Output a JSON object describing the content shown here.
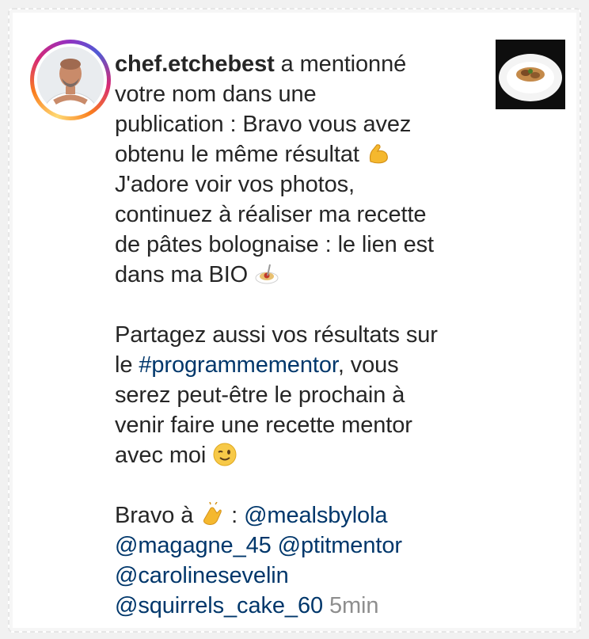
{
  "notification": {
    "username": "chef.etchebest",
    "lines": [
      " a mentionné",
      "votre nom dans une",
      "publication : Bravo vous avez",
      "obtenu le même résultat ",
      "J'adore voir vos photos,",
      "continuez à réaliser ma recette",
      "de pâtes bolognaise : le lien est",
      "dans ma BIO "
    ],
    "para2": {
      "line1": "Partagez aussi vos résultats sur",
      "line2_prefix": "le ",
      "hashtag": "#programmementor",
      "line2_suffix": ", vous",
      "line3": "serez peut-être le prochain à",
      "line4": "venir faire une recette mentor",
      "line5": "avec moi "
    },
    "para3": {
      "prefix": "Bravo à ",
      "colon": " : ",
      "mentions": [
        "@mealsbylola",
        "@magagne_45",
        "@ptitmentor",
        "@carolinesevelin",
        "@squirrels_cake_60"
      ],
      "time": "5min"
    },
    "emojis": [
      "flexed-biceps-emoji",
      "spaghetti-emoji",
      "winking-face-emoji",
      "clapping-hands-emoji"
    ]
  }
}
